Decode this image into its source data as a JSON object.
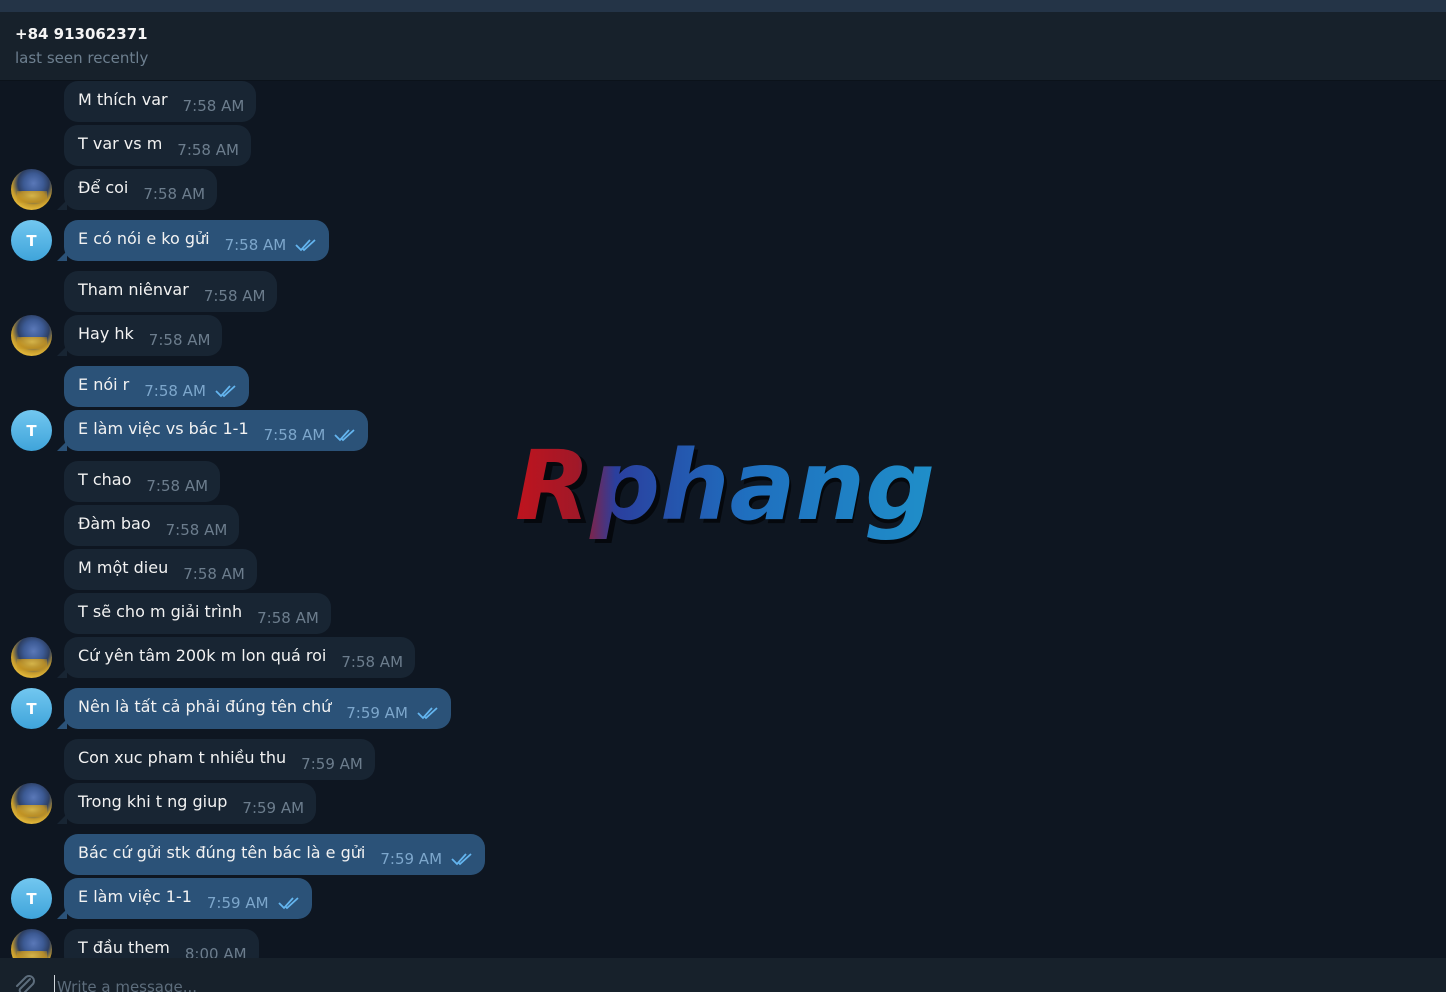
{
  "header": {
    "contact_name": "+84 913062371",
    "status": "last seen recently"
  },
  "messages": [
    {
      "text": "M thích var",
      "time": "7:58 AM",
      "outgoing": false
    },
    {
      "text": "T var vs m",
      "time": "7:58 AM",
      "outgoing": false
    },
    {
      "text": "Để coi",
      "time": "7:58 AM",
      "outgoing": false
    },
    {
      "text": "E có nói e ko gửi",
      "time": "7:58 AM",
      "outgoing": true,
      "read": true
    },
    {
      "text": "Tham niênvar",
      "time": "7:58 AM",
      "outgoing": false
    },
    {
      "text": "Hay hk",
      "time": "7:58 AM",
      "outgoing": false
    },
    {
      "text": "E nói r",
      "time": "7:58 AM",
      "outgoing": true,
      "read": true
    },
    {
      "text": "E làm việc vs bác 1-1",
      "time": "7:58 AM",
      "outgoing": true,
      "read": true
    },
    {
      "text": "T chao",
      "time": "7:58 AM",
      "outgoing": false
    },
    {
      "text": "Đàm bao",
      "time": "7:58 AM",
      "outgoing": false
    },
    {
      "text": "M một dieu",
      "time": "7:58 AM",
      "outgoing": false
    },
    {
      "text": "T sẽ cho m giải trình",
      "time": "7:58 AM",
      "outgoing": false
    },
    {
      "text": "Cứ yên tâm 200k m lon quá roi",
      "time": "7:58 AM",
      "outgoing": false
    },
    {
      "text": "Nên là tất cả phải đúng tên chứ",
      "time": "7:59 AM",
      "outgoing": true,
      "read": true
    },
    {
      "text": "Con xuc pham t  nhiều thu",
      "time": "7:59 AM",
      "outgoing": false
    },
    {
      "text": "Trong khi t ng giup",
      "time": "7:59 AM",
      "outgoing": false
    },
    {
      "text": "Bác cứ gửi stk đúng tên bác là e gửi",
      "time": "7:59 AM",
      "outgoing": true,
      "read": true
    },
    {
      "text": "E làm việc 1-1",
      "time": "7:59 AM",
      "outgoing": true,
      "read": true
    },
    {
      "text": "T đầu them",
      "time": "8:00 AM",
      "outgoing": false
    }
  ],
  "avatars": {
    "self_letter": "T"
  },
  "watermark": {
    "text": "Rphang"
  },
  "composer": {
    "placeholder": "Write a message..."
  },
  "colors": {
    "background": "#0e1621",
    "header": "#17212b",
    "incoming_bubble": "#182533",
    "outgoing_bubble": "#2b5278",
    "read_ticks": "#64b5ef",
    "watermark_red": "#c0141e",
    "watermark_blue": "#1f8fc9"
  }
}
